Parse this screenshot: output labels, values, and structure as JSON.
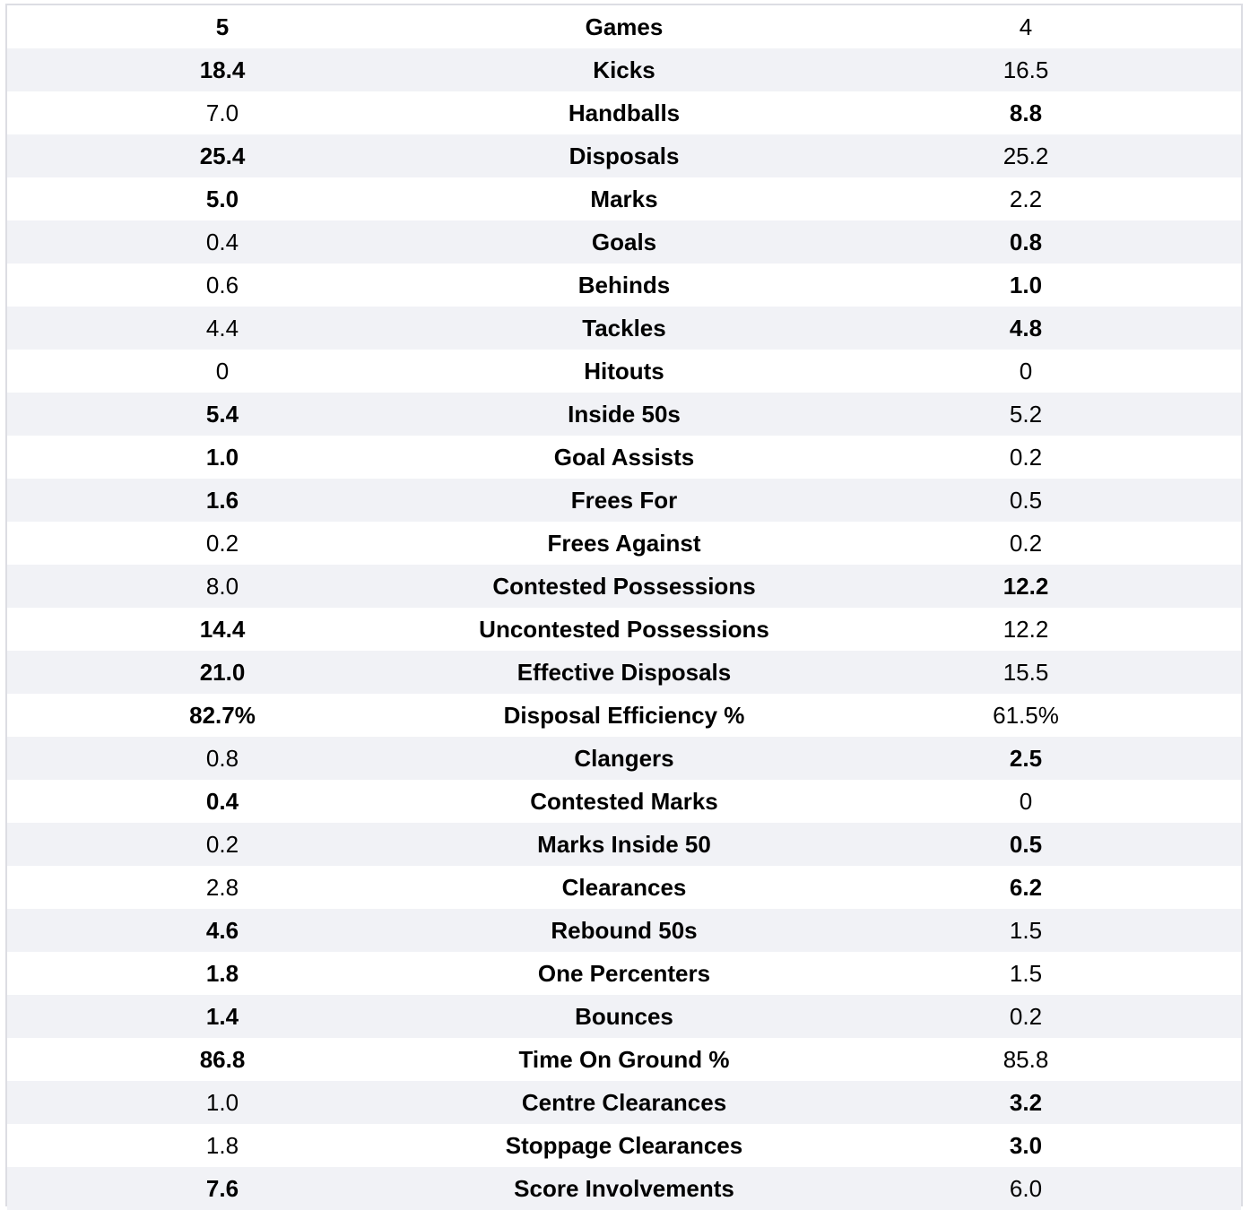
{
  "rows": [
    {
      "label": "Games",
      "left": "5",
      "right": "4",
      "bold": "left"
    },
    {
      "label": "Kicks",
      "left": "18.4",
      "right": "16.5",
      "bold": "left"
    },
    {
      "label": "Handballs",
      "left": "7.0",
      "right": "8.8",
      "bold": "right"
    },
    {
      "label": "Disposals",
      "left": "25.4",
      "right": "25.2",
      "bold": "left"
    },
    {
      "label": "Marks",
      "left": "5.0",
      "right": "2.2",
      "bold": "left"
    },
    {
      "label": "Goals",
      "left": "0.4",
      "right": "0.8",
      "bold": "right"
    },
    {
      "label": "Behinds",
      "left": "0.6",
      "right": "1.0",
      "bold": "right"
    },
    {
      "label": "Tackles",
      "left": "4.4",
      "right": "4.8",
      "bold": "right"
    },
    {
      "label": "Hitouts",
      "left": "0",
      "right": "0",
      "bold": "none"
    },
    {
      "label": "Inside 50s",
      "left": "5.4",
      "right": "5.2",
      "bold": "left"
    },
    {
      "label": "Goal Assists",
      "left": "1.0",
      "right": "0.2",
      "bold": "left"
    },
    {
      "label": "Frees For",
      "left": "1.6",
      "right": "0.5",
      "bold": "left"
    },
    {
      "label": "Frees Against",
      "left": "0.2",
      "right": "0.2",
      "bold": "none"
    },
    {
      "label": "Contested Possessions",
      "left": "8.0",
      "right": "12.2",
      "bold": "right"
    },
    {
      "label": "Uncontested Possessions",
      "left": "14.4",
      "right": "12.2",
      "bold": "left"
    },
    {
      "label": "Effective Disposals",
      "left": "21.0",
      "right": "15.5",
      "bold": "left"
    },
    {
      "label": "Disposal Efficiency %",
      "left": "82.7%",
      "right": "61.5%",
      "bold": "left"
    },
    {
      "label": "Clangers",
      "left": "0.8",
      "right": "2.5",
      "bold": "right"
    },
    {
      "label": "Contested Marks",
      "left": "0.4",
      "right": "0",
      "bold": "left"
    },
    {
      "label": "Marks Inside 50",
      "left": "0.2",
      "right": "0.5",
      "bold": "right"
    },
    {
      "label": "Clearances",
      "left": "2.8",
      "right": "6.2",
      "bold": "right"
    },
    {
      "label": "Rebound 50s",
      "left": "4.6",
      "right": "1.5",
      "bold": "left"
    },
    {
      "label": "One Percenters",
      "left": "1.8",
      "right": "1.5",
      "bold": "left"
    },
    {
      "label": "Bounces",
      "left": "1.4",
      "right": "0.2",
      "bold": "left"
    },
    {
      "label": "Time On Ground %",
      "left": "86.8",
      "right": "85.8",
      "bold": "left"
    },
    {
      "label": "Centre Clearances",
      "left": "1.0",
      "right": "3.2",
      "bold": "right"
    },
    {
      "label": "Stoppage Clearances",
      "left": "1.8",
      "right": "3.0",
      "bold": "right"
    },
    {
      "label": "Score Involvements",
      "left": "7.6",
      "right": "6.0",
      "bold": "left"
    }
  ]
}
